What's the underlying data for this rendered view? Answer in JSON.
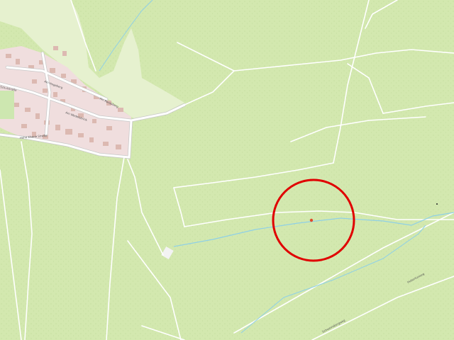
{
  "map": {
    "colors": {
      "forest": "#d3e8af",
      "meadow": "#e6f1cf",
      "residential": "#f0dede",
      "building": "#dcb9b1",
      "road": "#ffffff",
      "road_casing": "#c8c8c8",
      "path": "#ffffff",
      "stream": "#8fd0e6",
      "marker_ring": "#e00000",
      "marker_dot": "#e04a2a"
    },
    "labels": {
      "street_1": "Am Hegeberg",
      "street_2": "Am Wedelsbrink",
      "street_3": "Am Ronssberg",
      "street_4": "Hohe Ebene Straße",
      "street_5": "Schulstraße",
      "road_east": "Hubertusweg",
      "road_southeast": "Schweinsbergweg"
    }
  }
}
